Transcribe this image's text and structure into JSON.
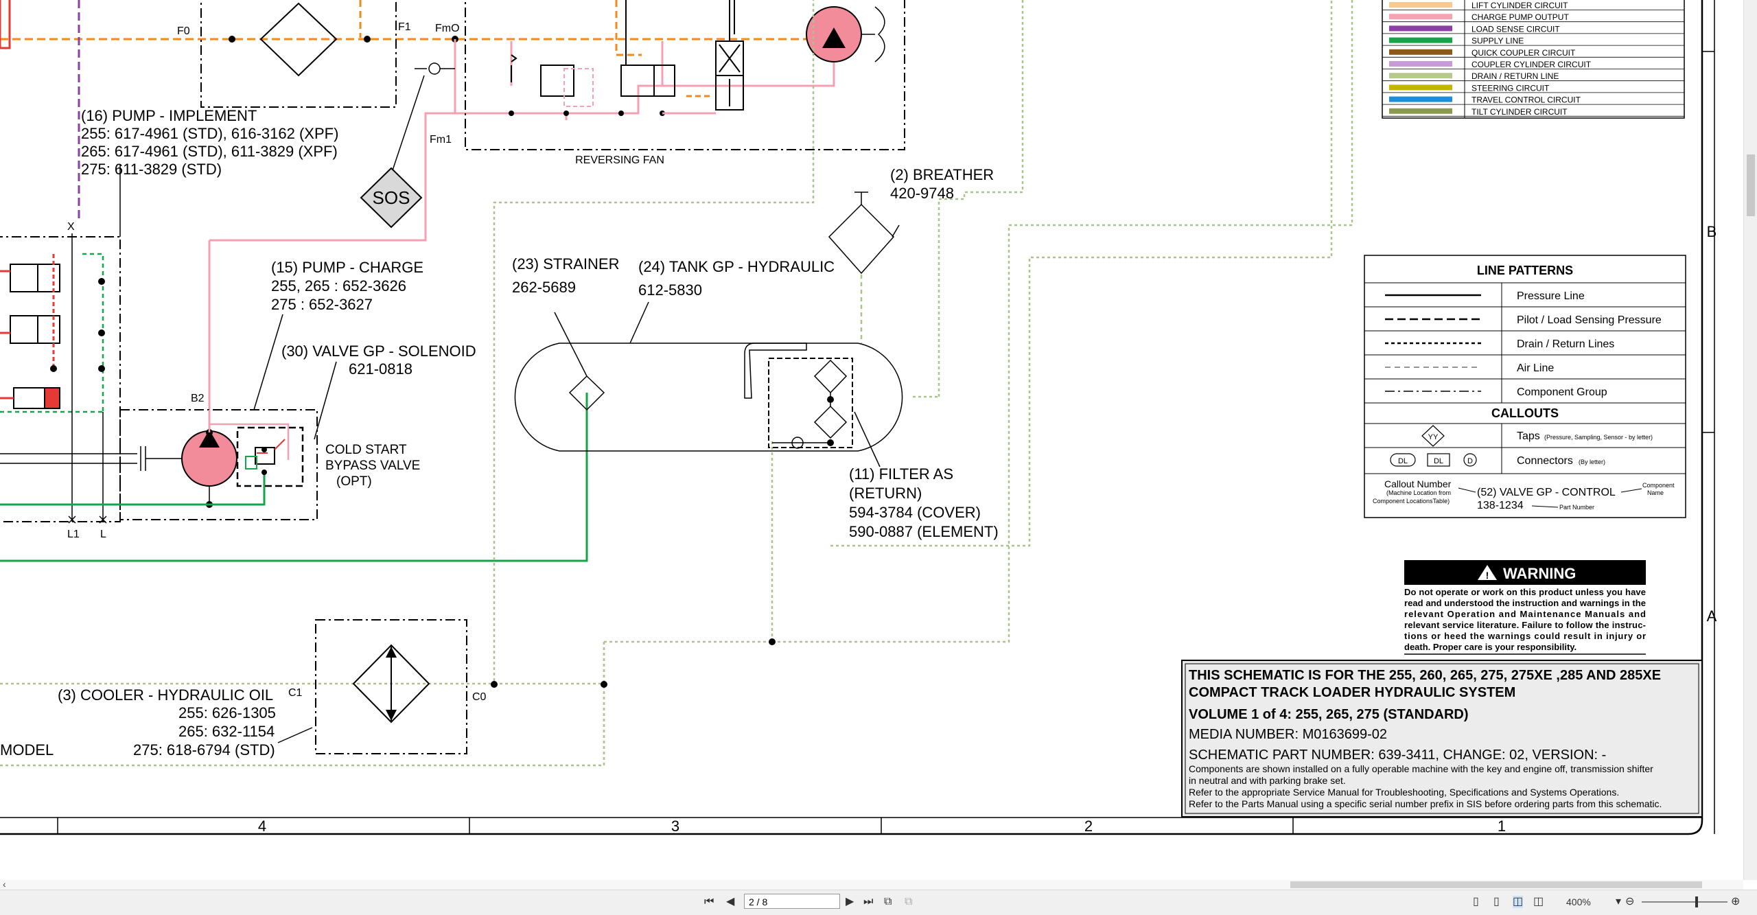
{
  "ports": {
    "f0": "F0",
    "f1": "F1",
    "fm0": "FmO",
    "fm1": "Fm1",
    "x": "X",
    "b2": "B2",
    "l1": "L1",
    "l": "L",
    "c1": "C1",
    "c0": "C0"
  },
  "sos": "SOS",
  "reversing_fan": "REVERSING FAN",
  "components": {
    "pump_implement": [
      "(16) PUMP - IMPLEMENT",
      "255: 617-4961 (STD), 616-3162 (XPF)",
      "265: 617-4961 (STD), 611-3829 (XPF)",
      "275: 611-3829 (STD)"
    ],
    "pump_charge": [
      "(15) PUMP - CHARGE",
      "255, 265 : 652-3626",
      "275 : 652-3627"
    ],
    "valve_solenoid": [
      "(30) VALVE GP - SOLENOID",
      "621-0818"
    ],
    "cold_start": [
      "COLD START",
      "BYPASS VALVE",
      "(OPT)"
    ],
    "strainer": [
      "(23) STRAINER",
      "262-5689"
    ],
    "tank": [
      "(24) TANK GP - HYDRAULIC",
      "612-5830"
    ],
    "breather": [
      "(2) BREATHER",
      "420-9748"
    ],
    "filter": [
      "(11) FILTER AS",
      "(RETURN)",
      "594-3784 (COVER)",
      "590-0887 (ELEMENT)"
    ],
    "cooler": [
      "(3) COOLER - HYDRAULIC OIL",
      "255: 626-1305",
      "265: 632-1154",
      "275: 618-6794 (STD)"
    ],
    "model_fragment": "MODEL"
  },
  "color_legend": [
    {
      "label": "LIFT CYLINDER CIRCUIT",
      "color": "#f9c98f"
    },
    {
      "label": "CHARGE PUMP OUTPUT",
      "color": "#f6a3b4"
    },
    {
      "label": "LOAD SENSE CIRCUIT",
      "color": "#8c3fa6"
    },
    {
      "label": "SUPPLY LINE",
      "color": "#16a34a"
    },
    {
      "label": "QUICK COUPLER CIRCUIT",
      "color": "#8b5a1b"
    },
    {
      "label": "COUPLER CYLINDER CIRCUIT",
      "color": "#c89bd8"
    },
    {
      "label": "DRAIN / RETURN LINE",
      "color": "#b5c98f"
    },
    {
      "label": "STEERING CIRCUIT",
      "color": "#c2b400"
    },
    {
      "label": "TRAVEL CONTROL CIRCUIT",
      "color": "#1f8ed8"
    },
    {
      "label": "TILT CYLINDER CIRCUIT",
      "color": "#8a9a4e"
    }
  ],
  "line_patterns": {
    "title": "LINE PATTERNS",
    "rows": [
      "Pressure Line",
      "Pilot / Load Sensing Pressure",
      "Drain / Return Lines",
      "Air Line",
      "Component Group"
    ],
    "callouts_title": "CALLOUTS",
    "taps_label": "Taps",
    "taps_note": "(Pressure, Sampling, Sensor - by letter)",
    "taps_symbol": "YY",
    "connectors_label": "Connectors",
    "connectors_note": "(By letter)",
    "connector_symbols": [
      "DL",
      "DL",
      "D"
    ],
    "example": {
      "callout_number": "Callout Number",
      "machine_location": "(Machine Location from",
      "component_table": "Component LocationsTable)",
      "valve": "(52) VALVE GP - CONTROL",
      "component": "Component",
      "name": "Name",
      "part": "138-1234",
      "part_number": "Part Number"
    }
  },
  "warning": {
    "title": "WARNING",
    "lines": [
      "Do not operate or work on this product unless you have",
      "read and understood the instruction and warnings in the",
      "relevant Operation and Maintenance Manuals and",
      "relevant service literature. Failure to follow the instruc-",
      "tions or heed the warnings could result in injury or",
      "death. Proper care is your responsibility."
    ]
  },
  "title_block": {
    "line1": "THIS SCHEMATIC IS FOR THE 255, 260, 265, 275, 275XE ,285 AND 285XE",
    "line2": "COMPACT TRACK LOADER HYDRAULIC SYSTEM",
    "volume": "VOLUME 1 of 4: 255, 265, 275 (STANDARD)",
    "media": "MEDIA NUMBER: M0163699-02",
    "part": "SCHEMATIC PART NUMBER: 639-3411, CHANGE: 02, VERSION: -",
    "notes": [
      "Components are shown installed on a fully operable machine with the key and engine off, transmission shifter",
      "in neutral and with parking brake set.",
      "Refer to the appropriate Service Manual for Troubleshooting, Specifications and Systems Operations.",
      "Refer to the Parts Manual using a specific serial number prefix in SIS before ordering parts from this schematic."
    ]
  },
  "zones": {
    "cols": [
      "4",
      "3",
      "2",
      "1"
    ],
    "rows": [
      "B",
      "A"
    ]
  },
  "viewer": {
    "page": "2 / 8",
    "zoom": "400%"
  }
}
